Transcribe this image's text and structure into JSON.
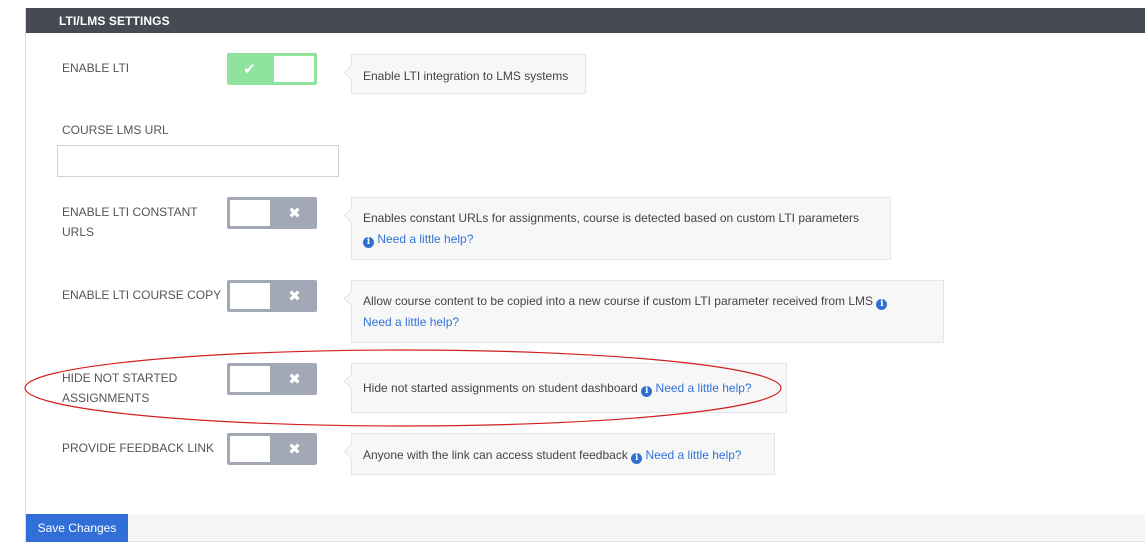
{
  "panel": {
    "title": "LTI/LMS SETTINGS"
  },
  "settings": [
    {
      "label": "ENABLE LTI",
      "state": "on",
      "description": "Enable LTI integration to LMS systems",
      "help_link": ""
    },
    {
      "label": "COURSE LMS URL",
      "input_value": "",
      "input_placeholder": ""
    },
    {
      "label": "ENABLE LTI CONSTANT URLS",
      "state": "off",
      "description": "Enables constant URLs for assignments, course is detected based on custom LTI parameters",
      "help_link": "Need a little help?"
    },
    {
      "label": "ENABLE LTI COURSE COPY",
      "state": "off",
      "description": "Allow course content to be copied into a new course if custom LTI parameter received from LMS",
      "help_link": "Need a little help?"
    },
    {
      "label": "HIDE NOT STARTED ASSIGNMENTS",
      "state": "off",
      "description": "Hide not started assignments on student dashboard",
      "help_link": "Need a little help?"
    },
    {
      "label": "PROVIDE FEEDBACK LINK",
      "state": "off",
      "description": "Anyone with the link can access student feedback",
      "help_link": "Need a little help?"
    }
  ],
  "icons": {
    "check": "✔",
    "cross": "✖",
    "info": "i"
  },
  "footer": {
    "save_label": "Save Changes"
  },
  "colors": {
    "toggle_on": "#8fe39d",
    "toggle_off": "#a3a8b6",
    "accent": "#2f6fd6",
    "annotation": "#d21f1f"
  }
}
